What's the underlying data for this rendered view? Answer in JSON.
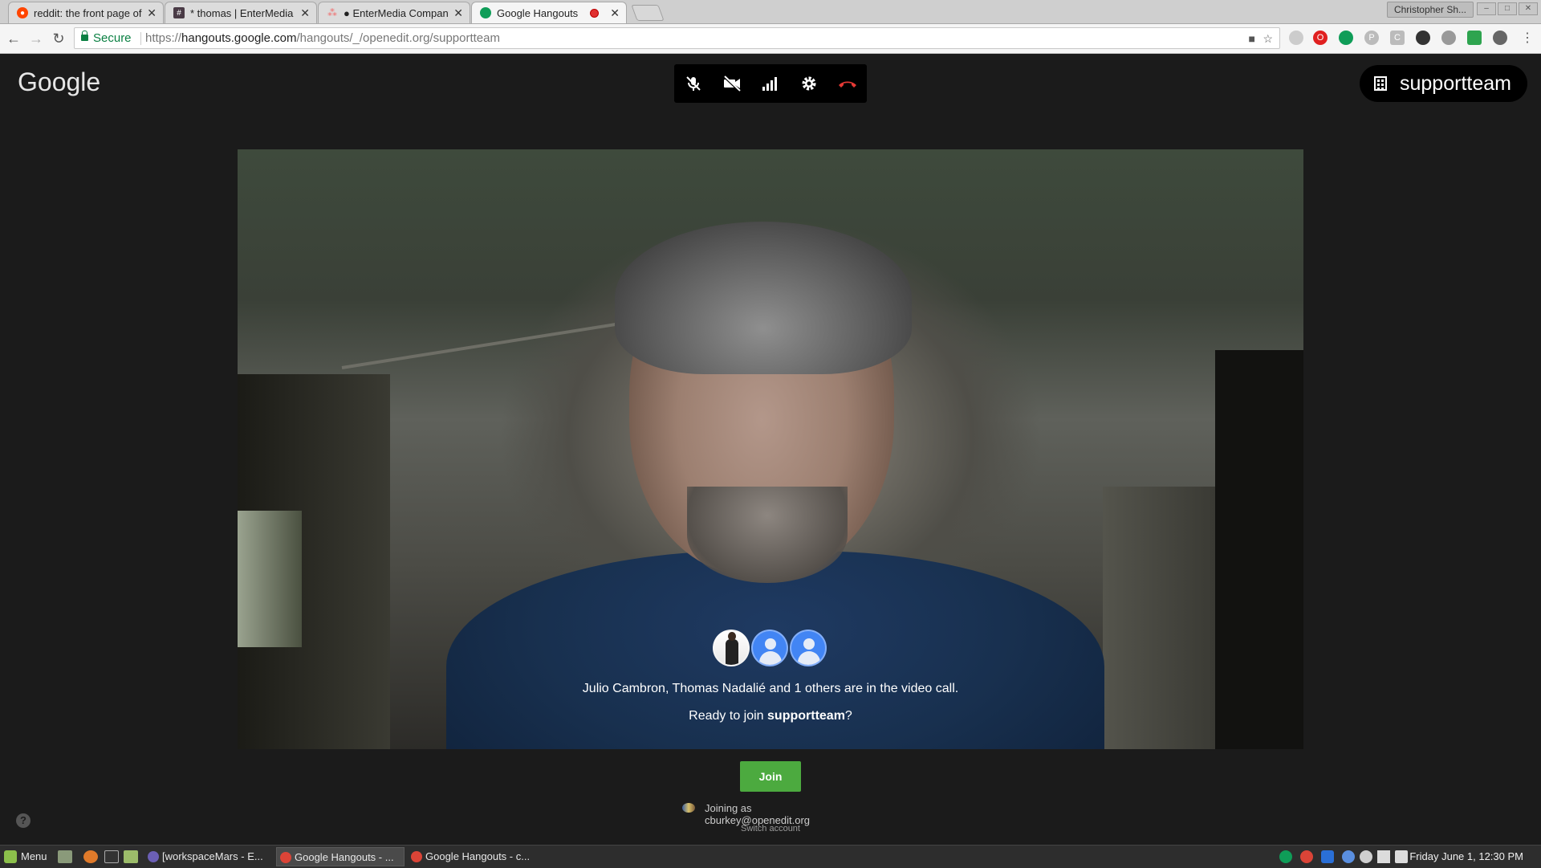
{
  "browser": {
    "tabs": [
      {
        "title": "reddit: the front page of",
        "favicon_color": "#ff4500",
        "favicon": "reddit-icon"
      },
      {
        "title": "* thomas | EnterMedia",
        "favicon_color": "#4a3b46",
        "favicon": "hash-icon"
      },
      {
        "title": "● EnterMedia Company",
        "favicon_color": "#f06a6a",
        "favicon": "asana-icon"
      },
      {
        "title": "Google Hangouts",
        "favicon_color": "#0f9d58",
        "favicon": "hangouts-icon",
        "active": true
      }
    ],
    "profile_name": "Christopher Sh...",
    "secure_label": "Secure",
    "url_scheme": "https://",
    "url_host": "hangouts.google.com",
    "url_path": "/hangouts/_/openedit.org/supportteam"
  },
  "app": {
    "logo_text": "Google",
    "room_name": "supportteam",
    "callbar": [
      "mic-off-icon",
      "camera-off-icon",
      "signal-bars-icon",
      "settings-gear-icon",
      "hang-up-icon"
    ],
    "in_call_text": "Julio Cambron, Thomas Nadalié and 1 others are in the video call.",
    "ready_prefix": "Ready to join ",
    "ready_room": "supportteam",
    "ready_suffix": "?",
    "join_label": "Join",
    "joining_as": "Joining as cburkey@openedit.org",
    "switch_account": "Switch account",
    "help_label": "?",
    "colors": {
      "join": "#4caa3f",
      "hangup": "#e53935",
      "avatar_blue": "#4285f4"
    }
  },
  "taskbar": {
    "menu_label": "Menu",
    "tasks": [
      {
        "label": "[workspaceMars - E...",
        "icon_color": "#6b5fb5"
      },
      {
        "label": "Google Hangouts - ...",
        "icon_color": "#db4437",
        "active": true
      },
      {
        "label": "Google Hangouts - c...",
        "icon_color": "#db4437"
      }
    ],
    "clock": "Friday June  1, 12:30 PM"
  }
}
